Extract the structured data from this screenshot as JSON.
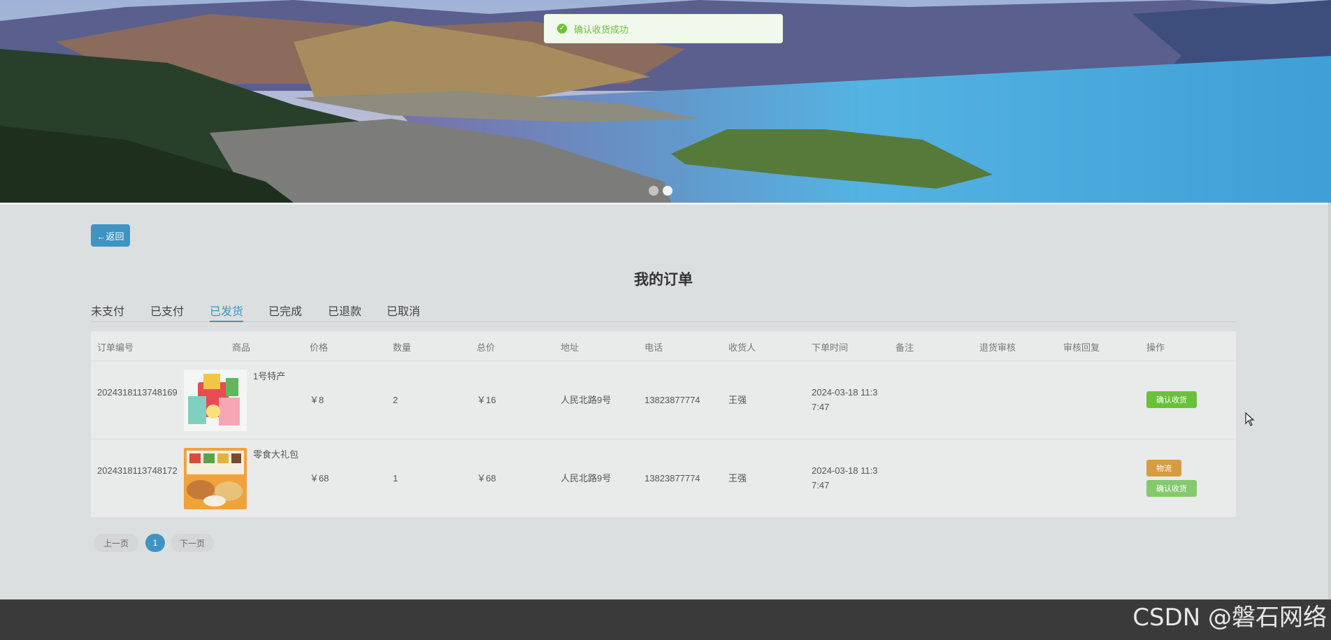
{
  "toast": {
    "message": "确认收货成功",
    "icon": "check-circle-icon"
  },
  "back_label": "←返回",
  "page_title": "我的订单",
  "tabs": [
    {
      "label": "未支付",
      "active": false
    },
    {
      "label": "已支付",
      "active": false
    },
    {
      "label": "已发货",
      "active": true
    },
    {
      "label": "已完成",
      "active": false
    },
    {
      "label": "已退款",
      "active": false
    },
    {
      "label": "已取消",
      "active": false
    }
  ],
  "table": {
    "headers": [
      "订单编号",
      "商品",
      "价格",
      "数量",
      "总价",
      "地址",
      "电话",
      "收货人",
      "下单时间",
      "备注",
      "退货审核",
      "审核回复",
      "操作"
    ],
    "rows": [
      {
        "order_no": "2024318113748169",
        "product": "1号特产",
        "price": "￥8",
        "qty": "2",
        "total": "￥16",
        "address": "人民北路9号",
        "phone": "13823877774",
        "receiver": "王强",
        "time": "2024-03-18 11:37:47",
        "remark": "",
        "return_review": "",
        "review_reply": "",
        "actions": [
          "确认收货"
        ]
      },
      {
        "order_no": "2024318113748172",
        "product": "零食大礼包",
        "price": "￥68",
        "qty": "1",
        "total": "￥68",
        "address": "人民北路9号",
        "phone": "13823877774",
        "receiver": "王强",
        "time": "2024-03-18 11:37:47",
        "remark": "",
        "return_review": "",
        "review_reply": "",
        "actions": [
          "物流",
          "确认收货"
        ]
      }
    ]
  },
  "pager": {
    "prev": "上一页",
    "current": "1",
    "next": "下一页"
  },
  "watermark": "CSDN @磐石网络",
  "colors": {
    "accent": "#3e94c3",
    "success": "#67c23a",
    "warning": "#d69c3f",
    "footer": "#3a3a3a"
  }
}
